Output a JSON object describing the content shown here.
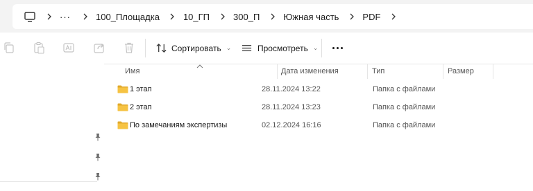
{
  "breadcrumb": {
    "overflow": "···",
    "items": [
      "100_Площадка",
      "10_ГП",
      "300_П",
      "Южная часть",
      "PDF"
    ]
  },
  "toolbar": {
    "sort_label": "Сортировать",
    "view_label": "Просмотреть"
  },
  "columns": {
    "name": "Имя",
    "date": "Дата изменения",
    "type": "Тип",
    "size": "Размер"
  },
  "files": [
    {
      "name": "1 этап",
      "date": "28.11.2024 13:22",
      "type": "Папка с файлами"
    },
    {
      "name": "2 этап",
      "date": "28.11.2024 13:23",
      "type": "Папка с файлами"
    },
    {
      "name": "По замечаниям экспертизы",
      "date": "02.12.2024 16:16",
      "type": "Папка с файлами"
    }
  ],
  "colors": {
    "folder": "#f6c343",
    "folder_dark": "#e1a92a",
    "chrome_bg": "#f3f3f3"
  }
}
